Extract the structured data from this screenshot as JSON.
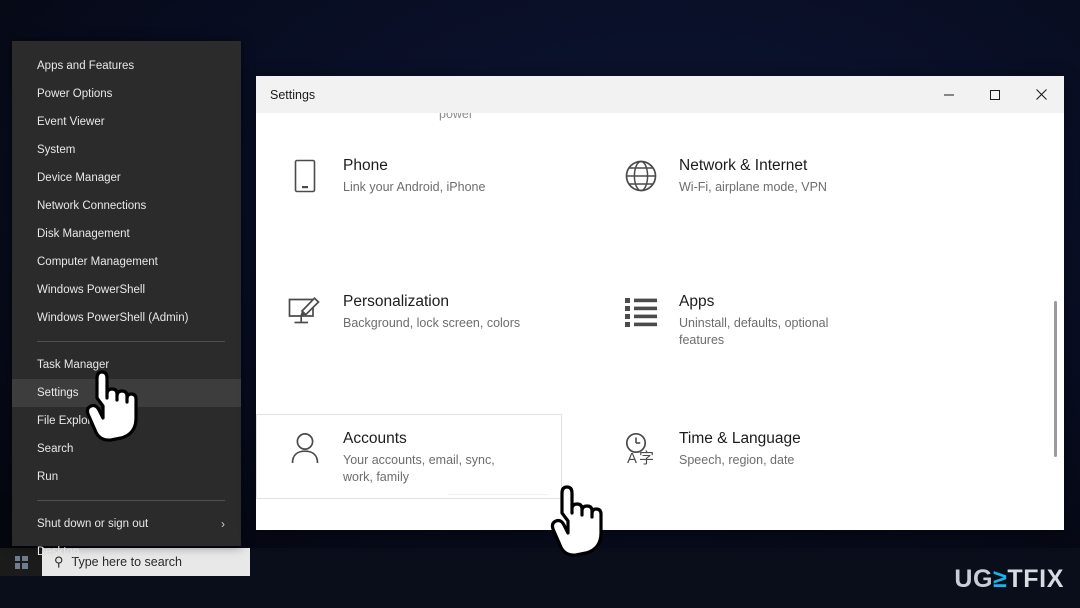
{
  "taskbar": {
    "start_icon": "windows-logo-icon",
    "search_placeholder": "Type here to search",
    "search_icon": "search-icon"
  },
  "winx_menu": {
    "groups": [
      {
        "items": [
          {
            "label": "Apps and Features",
            "highlight": false,
            "submenu": false
          },
          {
            "label": "Power Options",
            "highlight": false,
            "submenu": false
          },
          {
            "label": "Event Viewer",
            "highlight": false,
            "submenu": false
          },
          {
            "label": "System",
            "highlight": false,
            "submenu": false
          },
          {
            "label": "Device Manager",
            "highlight": false,
            "submenu": false
          },
          {
            "label": "Network Connections",
            "highlight": false,
            "submenu": false
          },
          {
            "label": "Disk Management",
            "highlight": false,
            "submenu": false
          },
          {
            "label": "Computer Management",
            "highlight": false,
            "submenu": false
          },
          {
            "label": "Windows PowerShell",
            "highlight": false,
            "submenu": false
          },
          {
            "label": "Windows PowerShell (Admin)",
            "highlight": false,
            "submenu": false
          }
        ]
      },
      {
        "items": [
          {
            "label": "Task Manager",
            "highlight": false,
            "submenu": false
          },
          {
            "label": "Settings",
            "highlight": true,
            "submenu": false
          },
          {
            "label": "File Explorer",
            "highlight": false,
            "submenu": false
          },
          {
            "label": "Search",
            "highlight": false,
            "submenu": false
          },
          {
            "label": "Run",
            "highlight": false,
            "submenu": false
          }
        ]
      },
      {
        "items": [
          {
            "label": "Shut down or sign out",
            "highlight": false,
            "submenu": true
          },
          {
            "label": "Desktop",
            "highlight": false,
            "submenu": false
          }
        ]
      }
    ],
    "submenu_chevron": "›"
  },
  "settings_window": {
    "title": "Settings",
    "controls": {
      "minimize": "minimize-icon",
      "maximize": "maximize-icon",
      "close": "close-icon"
    },
    "clipped_text": "power",
    "tiles": [
      {
        "title": "Phone",
        "subtitle": "Link your Android, iPhone",
        "icon": "phone-icon",
        "focused": false
      },
      {
        "title": "Network & Internet",
        "subtitle": "Wi-Fi, airplane mode, VPN",
        "icon": "globe-icon",
        "focused": false
      },
      {
        "title": "Personalization",
        "subtitle": "Background, lock screen, colors",
        "icon": "personalization-icon",
        "focused": false
      },
      {
        "title": "Apps",
        "subtitle": "Uninstall, defaults, optional features",
        "icon": "apps-list-icon",
        "focused": false
      },
      {
        "title": "Accounts",
        "subtitle": "Your accounts, email, sync, work, family",
        "icon": "person-icon",
        "focused": true
      },
      {
        "title": "Time & Language",
        "subtitle": "Speech, region, date",
        "icon": "time-language-icon",
        "focused": false
      }
    ]
  },
  "cursors": {
    "menu_cursor": "hand-pointer-cursor",
    "accounts_cursor": "hand-pointer-cursor"
  },
  "watermark": {
    "part1": "UG",
    "part2": "≥",
    "part3": "TFIX"
  }
}
